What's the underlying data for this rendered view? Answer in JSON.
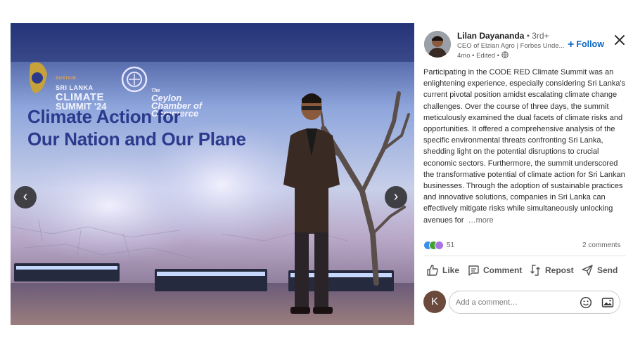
{
  "photo": {
    "event_logo": {
      "line0": "SUSTAIN",
      "line1": "SRI LANKA",
      "line2": "CLIMATE",
      "line3": "SUMMIT '24"
    },
    "chamber_logo": {
      "line0": "The",
      "line1": "Ceylon",
      "line2": "Chamber of",
      "line3": "Commerce"
    },
    "headline_line1": "Climate Action for",
    "headline_line2": "Our Nation and Our Plane",
    "prev_icon": "chevron-left-icon",
    "next_icon": "chevron-right-icon"
  },
  "post": {
    "author_name": "Lilan Dayananda",
    "author_degree": " • 3rd+",
    "author_headline": "CEO of Elzian Agro | Forbes Unde...",
    "meta": "4mo • Edited •",
    "follow_label": "Follow",
    "body": "Participating in the CODE RED Climate Summit was an enlightening experience, especially considering Sri Lanka's current pivotal position amidst escalating climate change challenges. Over the course of three days, the summit meticulously examined the dual facets of climate risks and opportunities. It offered a comprehensive analysis of the specific environmental threats confronting Sri Lanka, shedding light on the potential disruptions to crucial economic sectors. Furthermore, the summit underscored the transformative potential of climate action for Sri Lankan businesses. Through the adoption of sustainable practices and innovative solutions, companies in Sri Lanka can effectively mitigate risks while simultaneously unlocking avenues for",
    "more_label": "…more",
    "reaction_count": "51",
    "comments_count": "2 comments"
  },
  "actions": {
    "like": "Like",
    "comment": "Comment",
    "repost": "Repost",
    "send": "Send"
  },
  "composer": {
    "avatar_initial": "K",
    "placeholder": "Add a comment…"
  },
  "colors": {
    "link_blue": "#0a66c2",
    "headline_navy": "#2b3a8c",
    "like_blue": "#378fe9",
    "celebrate_green": "#44a02c",
    "support_purple": "#a872e8"
  }
}
